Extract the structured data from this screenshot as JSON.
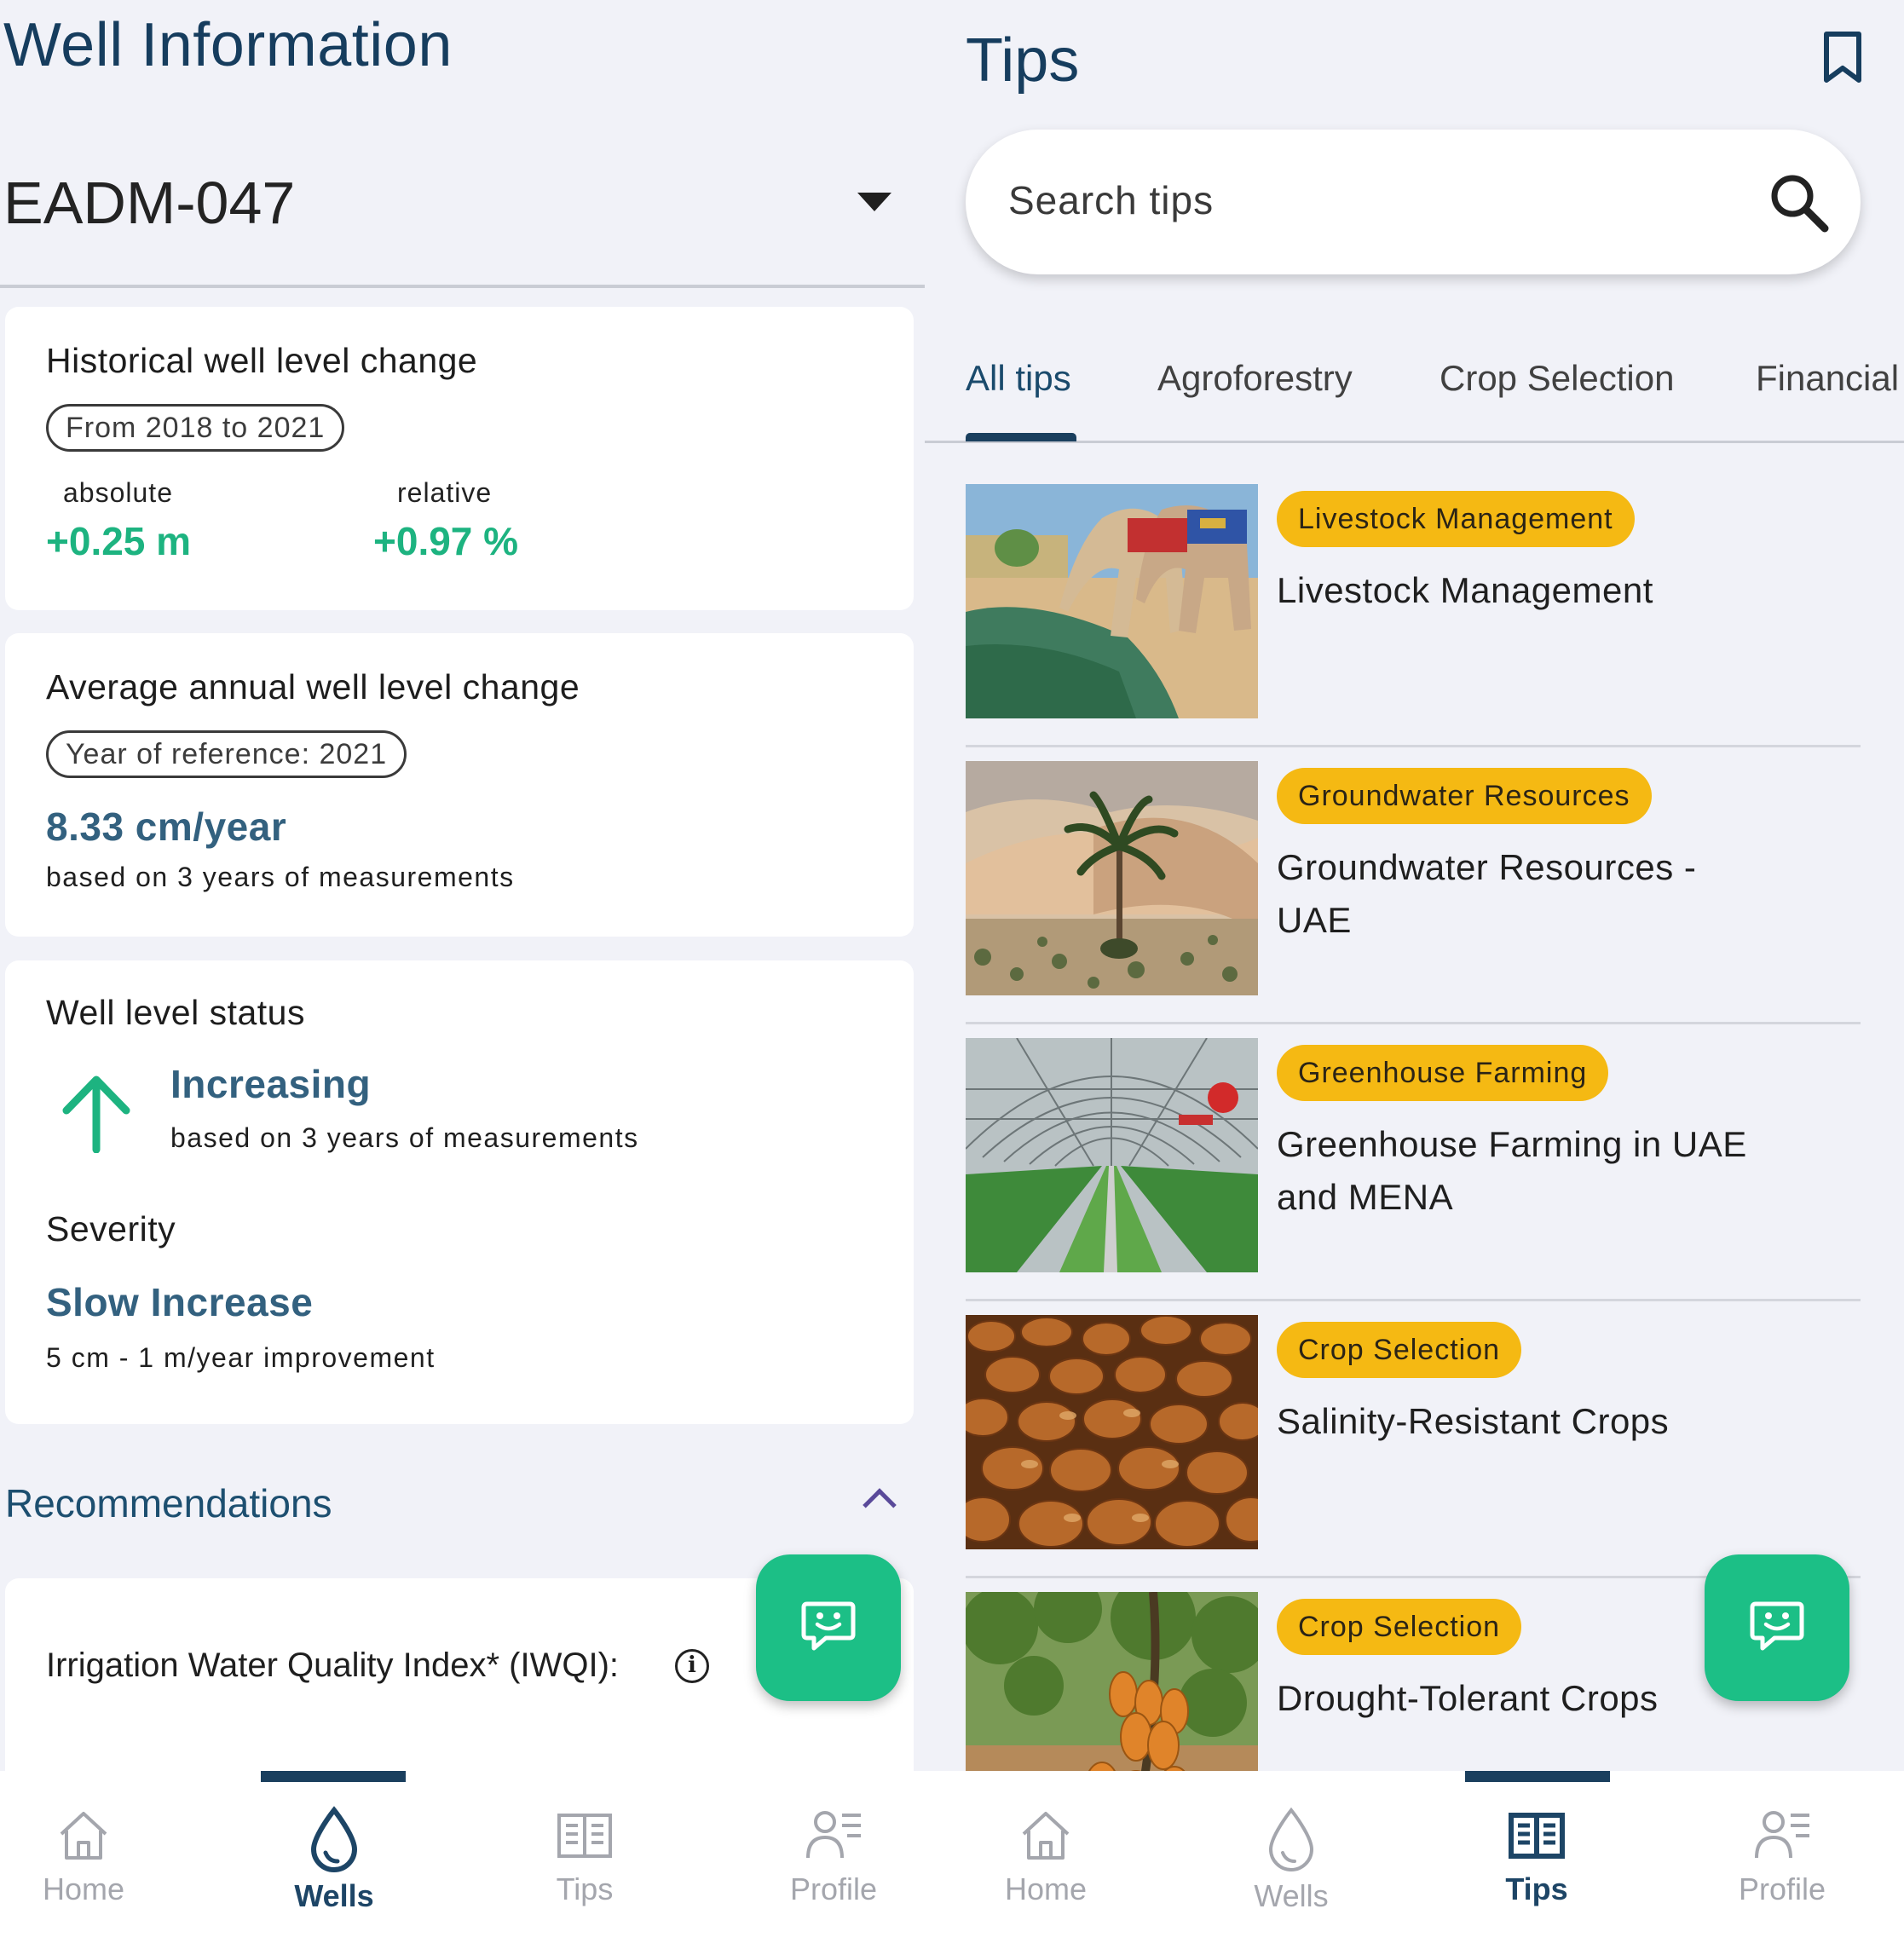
{
  "wells_screen": {
    "title": "Well Information",
    "selected_well": "EADM-047",
    "historical": {
      "title": "Historical well level change",
      "range_chip": "From 2018 to 2021",
      "absolute_label": "absolute",
      "absolute_value": "+0.25 m",
      "relative_label": "relative",
      "relative_value": "+0.97 %"
    },
    "average": {
      "title": "Average annual well level change",
      "reference_chip": "Year of reference: 2021",
      "value": "8.33 cm/year",
      "basis": "based on 3 years of measurements"
    },
    "status": {
      "title": "Well level status",
      "trend": "Increasing",
      "basis": "based on 3 years of measurements",
      "severity_label": "Severity",
      "severity_value": "Slow Increase",
      "severity_range": "5 cm - 1 m/year improvement"
    },
    "recommendations": {
      "heading": "Recommendations",
      "iwqi_label": "Irrigation Water Quality Index* (IWQI):"
    }
  },
  "tips_screen": {
    "title": "Tips",
    "search_placeholder": "Search tips",
    "tabs": [
      {
        "label": "All tips",
        "active": true
      },
      {
        "label": "Agroforestry",
        "active": false
      },
      {
        "label": "Crop Selection",
        "active": false
      },
      {
        "label": "Financial",
        "active": false
      }
    ],
    "items": [
      {
        "badge": "Livestock Management",
        "title": "Livestock Management",
        "image": "camels-drinking"
      },
      {
        "badge": "Groundwater Resources",
        "title": "Groundwater Resources - UAE",
        "image": "desert-palm"
      },
      {
        "badge": "Greenhouse Farming",
        "title": "Greenhouse Farming in UAE and MENA",
        "image": "greenhouse"
      },
      {
        "badge": "Crop Selection",
        "title": "Salinity-Resistant Crops",
        "image": "dates"
      },
      {
        "badge": "Crop Selection",
        "title": "Drought-Tolerant Crops",
        "image": "papaya-tree"
      }
    ]
  },
  "nav": {
    "home": "Home",
    "wells": "Wells",
    "tips": "Tips",
    "profile": "Profile",
    "left_active": "Wells",
    "right_active": "Tips"
  },
  "colors": {
    "primary": "#163d5e",
    "accent_green": "#1db380",
    "fab_green": "#1cbf86",
    "badge_yellow": "#f5b913",
    "value_blue": "#33617f",
    "background": "#f1f2f8"
  },
  "icons": [
    "caret-down-icon",
    "arrow-up-icon",
    "chevron-up-icon",
    "info-icon",
    "chat-bot-icon",
    "bookmark-icon",
    "search-icon",
    "home-icon",
    "water-drop-icon",
    "book-icon",
    "profile-icon"
  ]
}
